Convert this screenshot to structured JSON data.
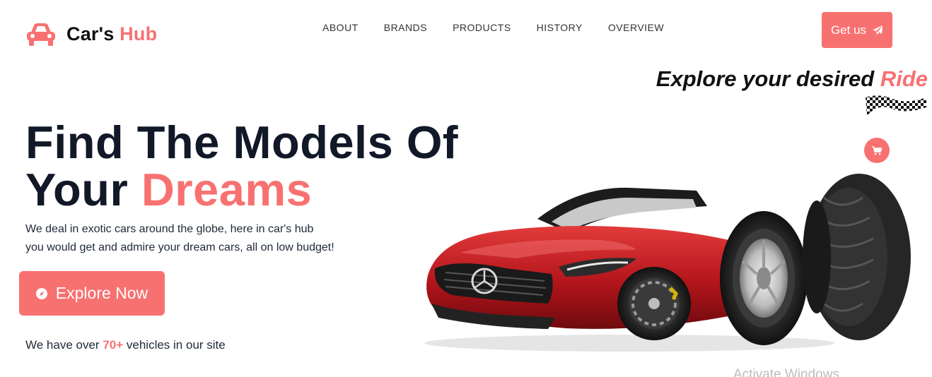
{
  "brand": {
    "name_part1": "Car's",
    "name_part2": "Hub"
  },
  "nav": {
    "items": [
      "ABOUT",
      "BRANDS",
      "PRODUCTS",
      "HISTORY",
      "OVERVIEW"
    ]
  },
  "cta": {
    "get_us_label": "Get us"
  },
  "tagline": {
    "part1": "Explore your desired",
    "accent": "Ride"
  },
  "hero": {
    "title_line1": "Find The Models Of",
    "title_line2_plain": "Your",
    "title_line2_accent": "Dreams",
    "description_line1": "We deal in exotic cars around the globe, here in car's hub",
    "description_line2": "you would get and admire your dream cars, all on low budget!",
    "explore_label": "Explore Now",
    "vehicles_prefix": "We have over",
    "vehicles_count": "70+",
    "vehicles_suffix": "vehicles in our site"
  },
  "watermark": "Activate Windows",
  "icons": {
    "logo": "car-icon",
    "get_us": "send-icon",
    "explore": "compass-icon",
    "cart": "cart-icon",
    "flag": "checkered-flag-icon"
  },
  "colors": {
    "accent": "#f87171",
    "heading": "#111827",
    "text": "#1f2937"
  }
}
